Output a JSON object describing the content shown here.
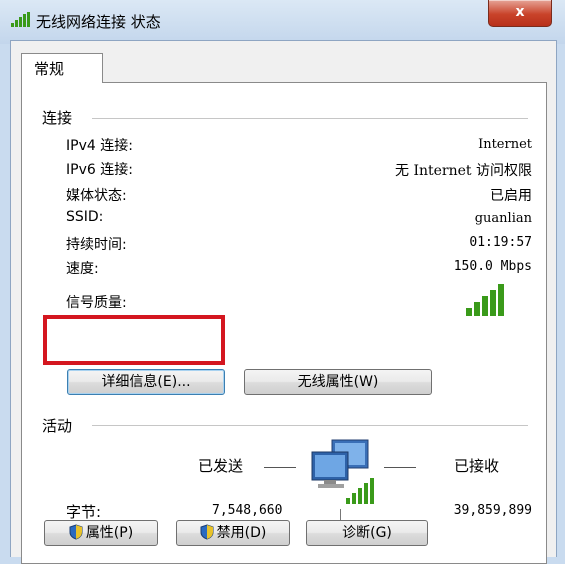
{
  "window": {
    "title": "无线网络连接 状态",
    "close_label": "x"
  },
  "tabs": [
    {
      "label": "常规",
      "active": true
    }
  ],
  "connection": {
    "title": "连接",
    "rows": [
      {
        "label": "IPv4 连接:",
        "value": "Internet"
      },
      {
        "label": "IPv6 连接:",
        "value": "无 Internet 访问权限"
      },
      {
        "label": "媒体状态:",
        "value": "已启用"
      },
      {
        "label": "SSID:",
        "value": "guanlian"
      },
      {
        "label": "持续时间:",
        "value": "01:19:57"
      },
      {
        "label": "速度:",
        "value": "150.0 Mbps"
      }
    ],
    "signal_label": "信号质量:",
    "signal_bars": 5,
    "signal_max": 5,
    "details_button": "详细信息(E)...",
    "wireless_props_button": "无线属性(W)"
  },
  "activity": {
    "title": "活动",
    "sent_label": "已发送",
    "received_label": "已接收",
    "bytes_label": "字节:",
    "bytes_sent": "7,548,660",
    "bytes_received": "39,859,899"
  },
  "buttons": {
    "properties": "属性(P)",
    "disable": "禁用(D)",
    "diagnose": "诊断(G)"
  },
  "colors": {
    "highlight": "#d4161f",
    "signal": "#3a9a1a",
    "title_bg": "#c9dbef",
    "close_bg": "#c9432a"
  },
  "icons": {
    "title": "wireless-signal-icon",
    "network": "network-computers-icon",
    "shield": "uac-shield-icon"
  }
}
